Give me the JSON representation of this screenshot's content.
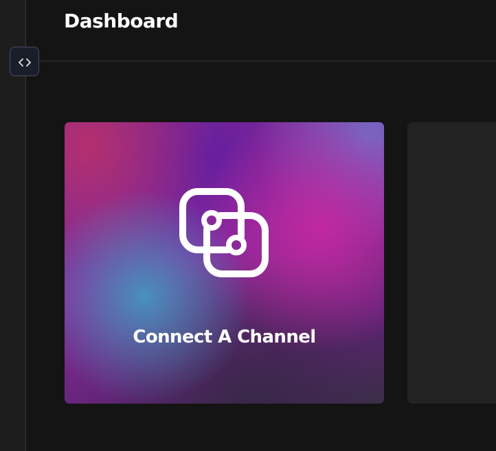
{
  "header": {
    "title": "Dashboard"
  },
  "sidebar": {
    "toggle_icon": "code-brackets-icon"
  },
  "cards": [
    {
      "label": "Connect A Channel",
      "icon": "link-channel-icon"
    },
    {
      "label": ""
    }
  ],
  "colors": {
    "background": "#141414",
    "sidebar": "#1d1d1d",
    "card_placeholder": "#222222",
    "text": "#ffffff"
  }
}
